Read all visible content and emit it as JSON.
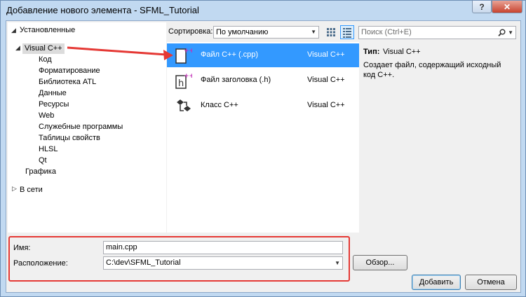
{
  "window": {
    "title": "Добавление нового элемента - SFML_Tutorial",
    "help_label": "?",
    "close_label": "✕"
  },
  "tree": {
    "installed_label": "Установленные",
    "visual_cpp_label": "Visual C++",
    "children": [
      "Код",
      "Форматирование",
      "Библиотека ATL",
      "Данные",
      "Ресурсы",
      "Web",
      "Служебные программы",
      "Таблицы свойств",
      "HLSL",
      "Qt"
    ],
    "graphics_label": "Графика",
    "online_label": "В сети"
  },
  "toolbar": {
    "sort_label": "Сортировка:",
    "sort_value": "По умолчанию",
    "search_placeholder": "Поиск (Ctrl+E)"
  },
  "templates": [
    {
      "name": "Файл C++ (.cpp)",
      "language": "Visual C++",
      "icon": "cpp-file-icon",
      "selected": true
    },
    {
      "name": "Файл заголовка (.h)",
      "language": "Visual C++",
      "icon": "header-file-icon",
      "selected": false
    },
    {
      "name": "Класс C++",
      "language": "Visual C++",
      "icon": "cpp-class-icon",
      "selected": false
    }
  ],
  "details": {
    "type_label": "Тип:",
    "type_value": "Visual C++",
    "description": "Создает файл, содержащий исходный код C++."
  },
  "form": {
    "name_label": "Имя:",
    "name_value": "main.cpp",
    "location_label": "Расположение:",
    "location_value": "C:\\dev\\SFML_Tutorial"
  },
  "buttons": {
    "browse": "Обзор...",
    "add": "Добавить",
    "cancel": "Отмена"
  },
  "colors": {
    "selection": "#3399ff",
    "annotation": "#e53935"
  }
}
